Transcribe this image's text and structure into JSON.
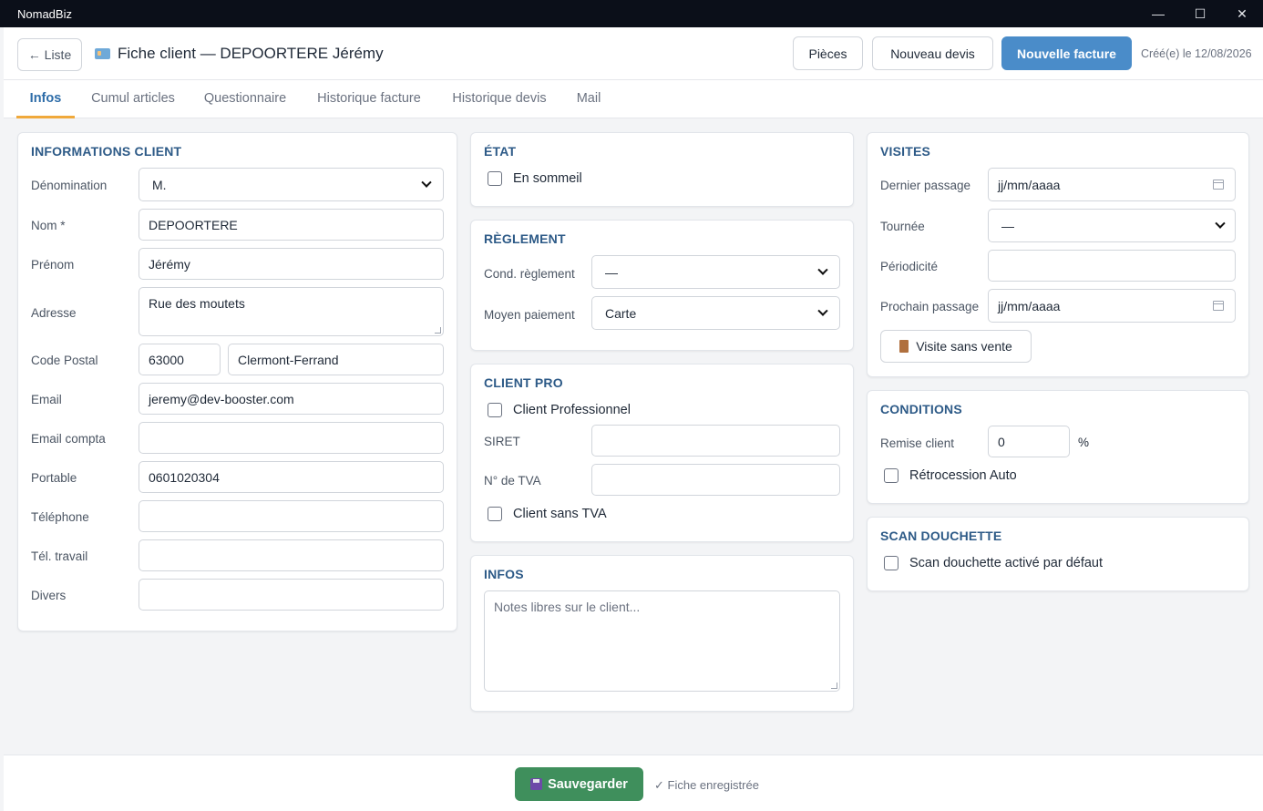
{
  "window": {
    "app_title": "NomadBiz",
    "minimize": "—",
    "maximize": "☐",
    "close": "✕"
  },
  "header": {
    "back_label": "← Liste",
    "title": "Fiche client — DEPOORTERE Jérémy",
    "btn_pieces": "Pièces",
    "btn_devis": "Nouveau devis",
    "btn_facture": "Nouvelle facture",
    "created": "Créé(e) le 12/08/2026"
  },
  "tabs": [
    "Infos",
    "Cumul articles",
    "Questionnaire",
    "Historique facture",
    "Historique devis",
    "Mail"
  ],
  "client": {
    "title": "INFORMATIONS CLIENT",
    "labels": {
      "denomination": "Dénomination",
      "nom": "Nom *",
      "prenom": "Prénom",
      "adresse": "Adresse",
      "cp": "Code Postal",
      "email": "Email",
      "email_compta": "Email compta",
      "portable": "Portable",
      "telephone": "Téléphone",
      "tel_travail": "Tél. travail",
      "divers": "Divers"
    },
    "values": {
      "denomination": "M.",
      "nom": "DEPOORTERE",
      "prenom": "Jérémy",
      "adresse": "Rue des moutets",
      "cp": "63000",
      "ville": "Clermont-Ferrand",
      "email": "jeremy@dev-booster.com",
      "email_compta": "",
      "portable": "0601020304",
      "telephone": "",
      "tel_travail": "",
      "divers": ""
    }
  },
  "etat": {
    "title": "ÉTAT",
    "sommeil": "En sommeil"
  },
  "reglement": {
    "title": "RÈGLEMENT",
    "cond_label": "Cond. règlement",
    "cond_value": "—",
    "moyen_label": "Moyen paiement",
    "moyen_value": "Carte"
  },
  "pro": {
    "title": "CLIENT PRO",
    "professionnel": "Client Professionnel",
    "siret_label": "SIRET",
    "siret_value": "",
    "tva_label": "N° de TVA",
    "tva_value": "",
    "sans_tva": "Client sans TVA"
  },
  "infos": {
    "title": "INFOS",
    "placeholder": "Notes libres sur le client..."
  },
  "visites": {
    "title": "VISITES",
    "dernier_label": "Dernier passage",
    "dernier_value": "jj/mm/aaaa",
    "tournee_label": "Tournée",
    "tournee_value": "—",
    "periodicite_label": "Périodicité",
    "periodicite_value": "",
    "prochain_label": "Prochain passage",
    "prochain_value": "jj/mm/aaaa",
    "btn_visite": "Visite sans vente"
  },
  "conditions": {
    "title": "CONDITIONS",
    "remise_label": "Remise client",
    "remise_value": "0",
    "remise_unit": "%",
    "retro": "Rétrocession Auto"
  },
  "scan": {
    "title": "SCAN DOUCHETTE",
    "active": "Scan douchette activé par défaut"
  },
  "footer": {
    "save": "Sauvegarder",
    "status": "✓ Fiche enregistrée"
  }
}
